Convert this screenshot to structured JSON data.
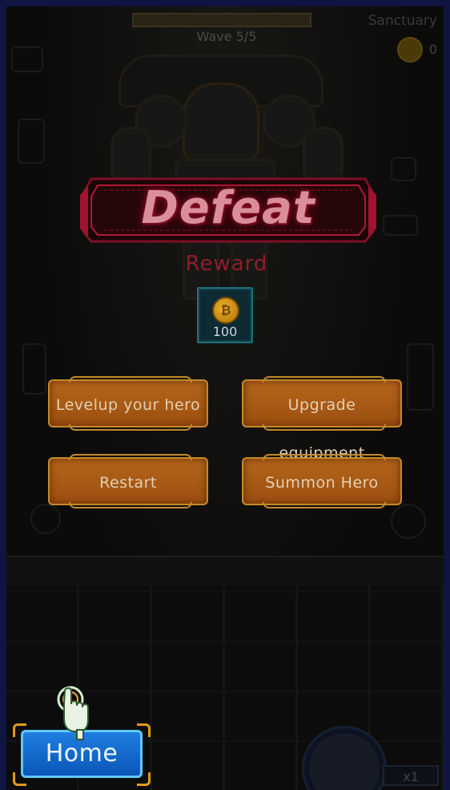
{
  "hud": {
    "wave_text": "Wave 5/5",
    "location": "Sanctuary",
    "coins": "0"
  },
  "result": {
    "title": "Defeat",
    "reward_label": "Reward",
    "reward_amount": "100",
    "reward_icon": "coin-icon"
  },
  "actions": {
    "levelup": "Levelup your hero",
    "upgrade": "Upgrade equipment",
    "restart": "Restart",
    "summon": "Summon Hero"
  },
  "footer": {
    "home_label": "Home",
    "speed": "x1"
  },
  "colors": {
    "defeat": "#d98f9a",
    "reward_label": "#8e1e2a",
    "action_button": "#b4661b",
    "home_button": "#1e7fe0",
    "frame": "#0f1440"
  }
}
